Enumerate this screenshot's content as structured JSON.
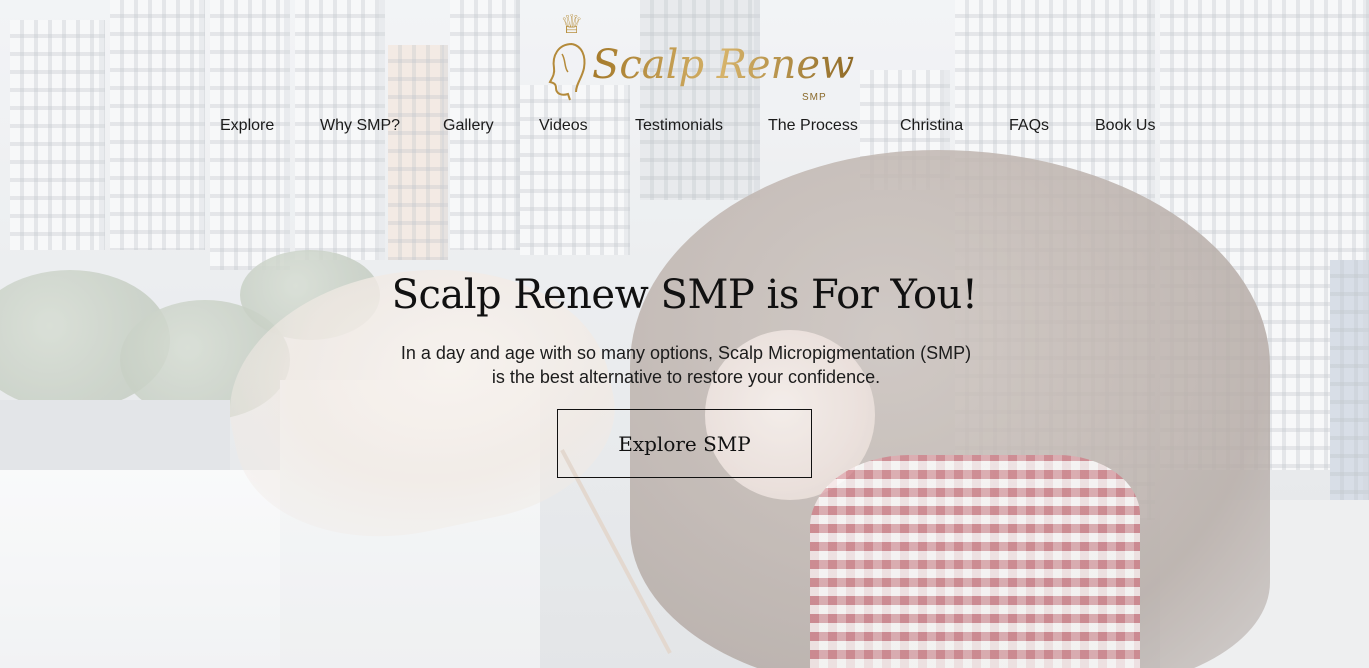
{
  "brand": {
    "logo_text": "Scalp Renew",
    "logo_sub": "SMP",
    "accent_gold": "#b48a3a"
  },
  "nav": {
    "items": [
      {
        "label": "Explore"
      },
      {
        "label": "Why SMP?"
      },
      {
        "label": "Gallery"
      },
      {
        "label": "Videos"
      },
      {
        "label": "Testimonials"
      },
      {
        "label": "The Process"
      },
      {
        "label": "Christina"
      },
      {
        "label": "FAQs"
      },
      {
        "label": "Book Us"
      }
    ]
  },
  "hero": {
    "title": "Scalp Renew SMP is For You!",
    "subtitle": "In a day and age with so many options, Scalp Micropigmentation (SMP) is the best alternative to restore your confidence.",
    "cta_label": "Explore SMP"
  }
}
